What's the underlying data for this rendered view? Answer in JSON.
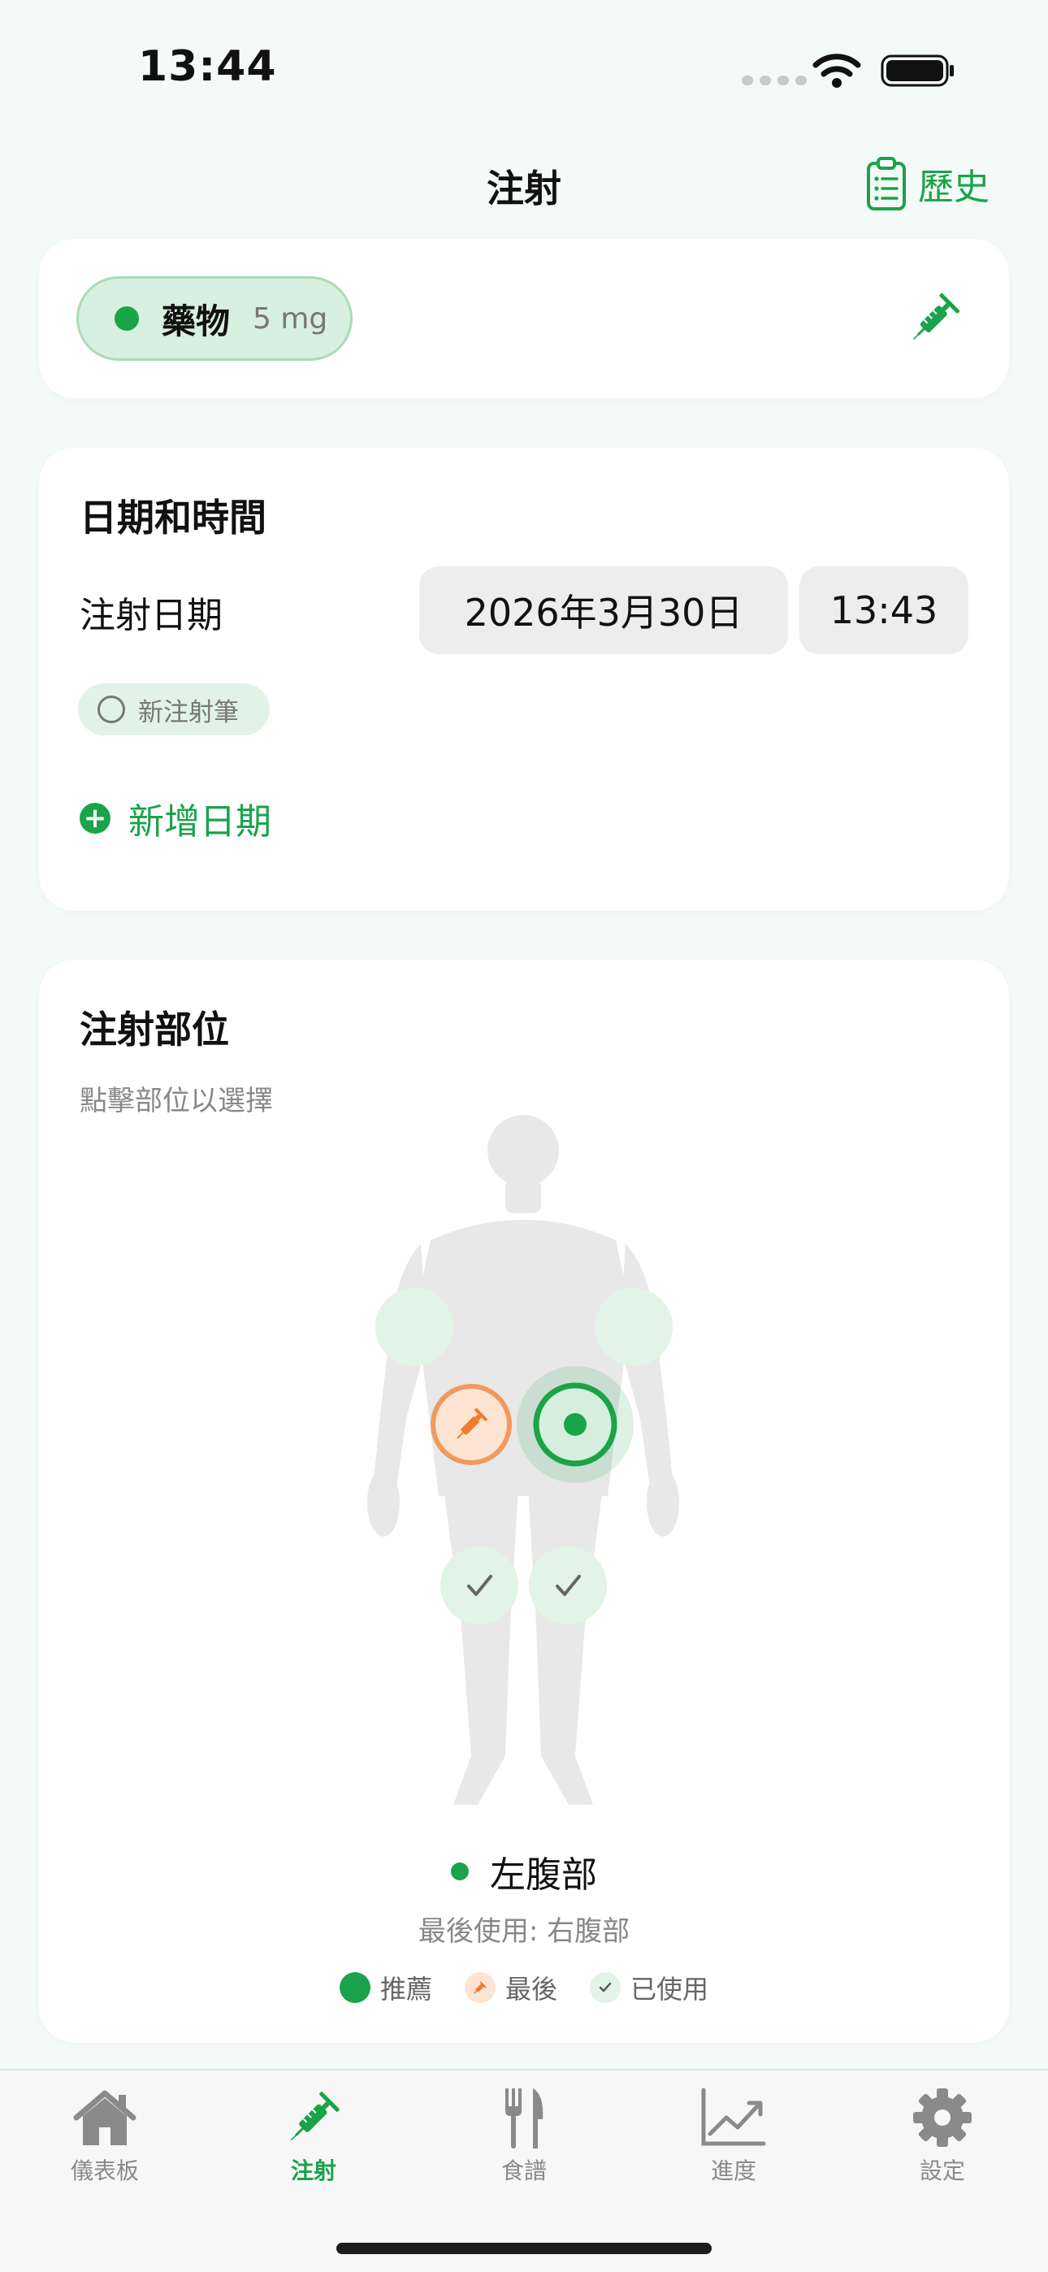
{
  "status_bar": {
    "time": "13:44"
  },
  "header": {
    "title": "注射",
    "history_label": "歷史"
  },
  "medication": {
    "name": "藥物",
    "dose": "5 mg"
  },
  "date_time": {
    "section_title": "日期和時間",
    "injection_date_label": "注射日期",
    "date_value": "2026年3月30日",
    "time_value": "13:43",
    "new_pen_label": "新注射筆",
    "add_date_label": "新增日期"
  },
  "injection_site": {
    "section_title": "注射部位",
    "hint": "點擊部位以選擇",
    "selected_site": "左腹部",
    "last_used": "最後使用: 右腹部",
    "legend": {
      "recommended": "推薦",
      "last": "最後",
      "used": "已使用"
    }
  },
  "tabs": [
    {
      "label": "儀表板",
      "icon": "home-icon"
    },
    {
      "label": "注射",
      "icon": "syringe-icon"
    },
    {
      "label": "食譜",
      "icon": "fork-knife-icon"
    },
    {
      "label": "進度",
      "icon": "chart-icon"
    },
    {
      "label": "設定",
      "icon": "gear-icon"
    }
  ],
  "colors": {
    "accent": "#1aa34a",
    "last": "#f07a2a",
    "background": "#f4faf7"
  }
}
